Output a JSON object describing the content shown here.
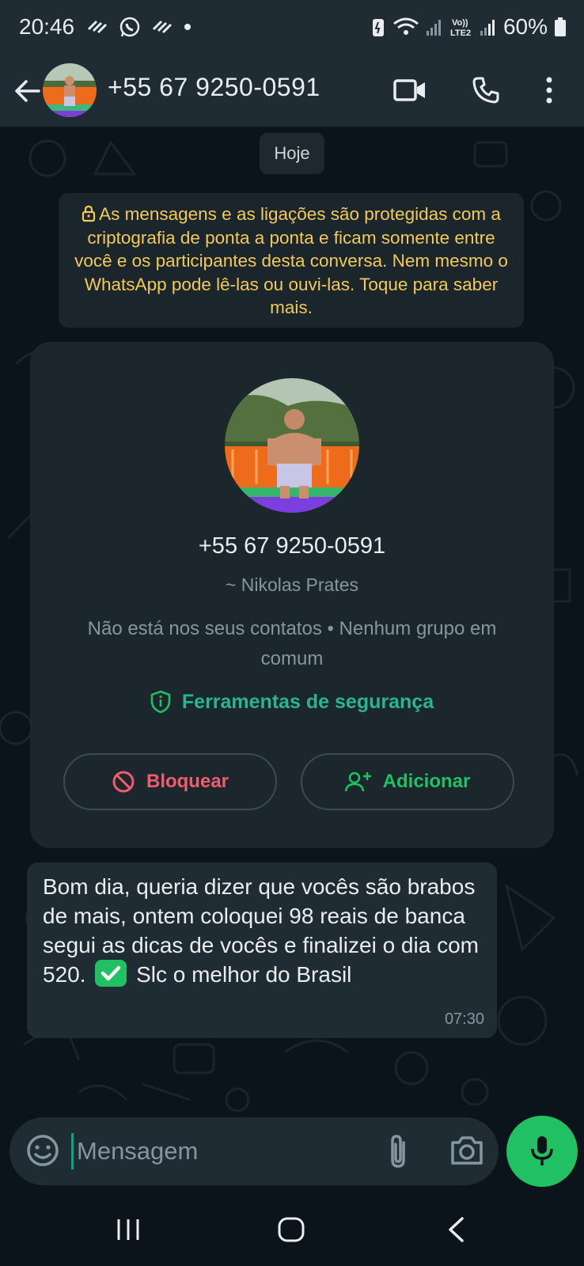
{
  "status_bar": {
    "time": "20:46",
    "battery": "60%"
  },
  "header": {
    "title": "+55 67 9250-0591"
  },
  "chat": {
    "date_chip": "Hoje",
    "encryption_notice": "As mensagens e as ligações são protegidas com a criptografia de ponta a ponta e ficam somente entre você e os participantes desta conversa. Nem mesmo o WhatsApp pode lê-las ou ouvi-las. Toque para saber mais.",
    "contact_card": {
      "phone": "+55 67 9250-0591",
      "name": "~ Nikolas Prates",
      "info": "Não está nos seus contatos • Nenhum grupo em comum",
      "security_tools": "Ferramentas de segurança",
      "block_label": "Bloquear",
      "add_label": "Adicionar"
    },
    "message": {
      "text_before": "Bom dia, queria dizer que vocês são brabos de mais, ontem coloquei 98 reais de banca segui as dicas de vocês e finalizei o dia com 520.",
      "text_after": "Slc o melhor do Brasil",
      "time": "07:30"
    }
  },
  "input": {
    "placeholder": "Mensagem"
  },
  "colors": {
    "accent": "#21c063",
    "notice": "#f3c95a",
    "danger": "#f15c6d"
  }
}
